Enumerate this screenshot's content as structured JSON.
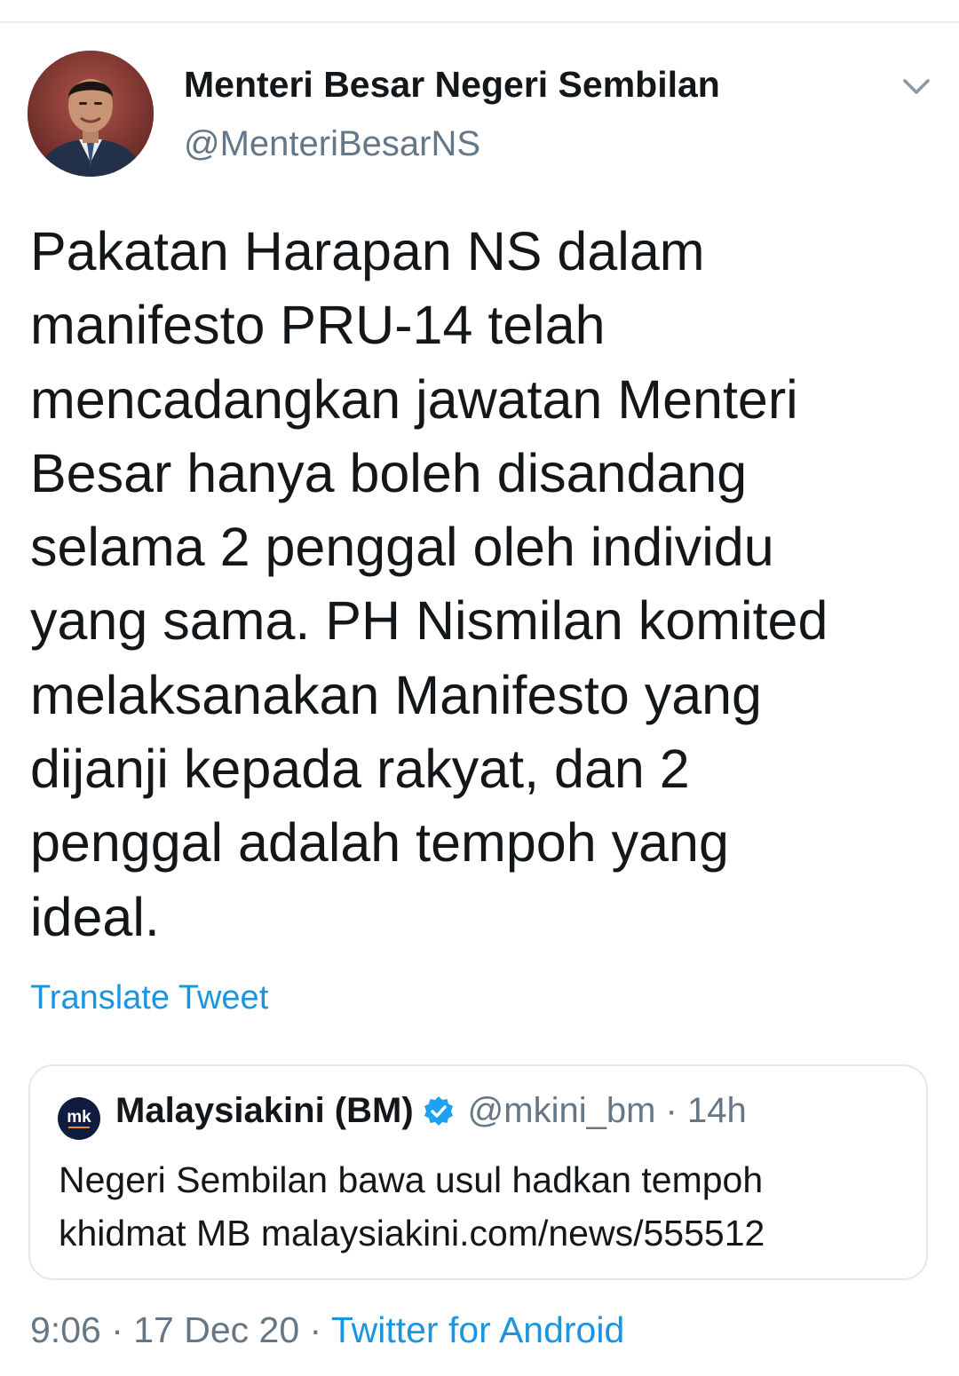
{
  "tweet": {
    "author": {
      "display_name": "Menteri Besar Negeri Sembilan",
      "handle": "@MenteriBesarNS",
      "avatar_icon": "profile-photo"
    },
    "text": "Pakatan Harapan NS dalam\nmanifesto PRU-14 telah\nmencadangkan jawatan Menteri\nBesar hanya boleh disandang\nselama 2 penggal oleh individu\nyang sama. PH Nismilan komited\nmelaksanakan Manifesto yang\ndijanji kepada rakyat, dan 2\npenggal adalah tempoh yang\nideal.",
    "translate_label": "Translate Tweet",
    "quoted": {
      "logo_text": "mk",
      "display_name": "Malaysiakini (BM)",
      "verified": true,
      "handle_and_time": "@mkini_bm · 14h",
      "text": "Negeri Sembilan bawa usul hadkan tempoh\nkhidmat MB malaysiakini.com/news/555512"
    },
    "meta": {
      "timestamp": "9:06 · 17 Dec 20 · ",
      "source": "Twitter for Android"
    }
  },
  "colors": {
    "link": "#1b95e0",
    "secondary_text": "#657786",
    "border": "#e1e8ed",
    "verified": "#1da1f2"
  }
}
